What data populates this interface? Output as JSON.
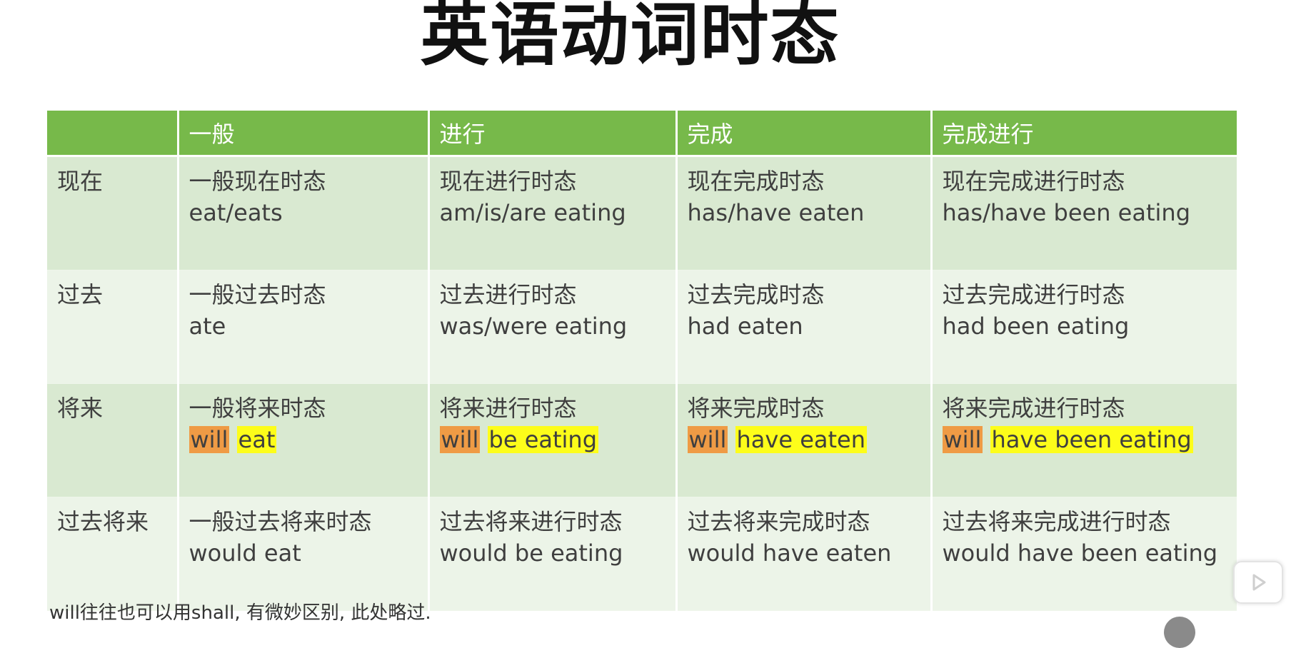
{
  "title": "英语动词时态",
  "table": {
    "headers": [
      "",
      "一般",
      "进行",
      "完成",
      "完成进行"
    ],
    "rows": [
      {
        "label": "现在",
        "cells": [
          {
            "name": "一般现在时态",
            "form": "eat/eats"
          },
          {
            "name": "现在进行时态",
            "form": "am/is/are eating"
          },
          {
            "name": "现在完成时态",
            "form": "has/have eaten"
          },
          {
            "name": "现在完成进行时态",
            "form": "has/have been eating"
          }
        ]
      },
      {
        "label": "过去",
        "cells": [
          {
            "name": "一般过去时态",
            "form": "ate"
          },
          {
            "name": "过去进行时态",
            "form": "was/were eating"
          },
          {
            "name": "过去完成时态",
            "form": "had eaten"
          },
          {
            "name": "过去完成进行时态",
            "form": "had been eating"
          }
        ]
      },
      {
        "label": "将来",
        "cells": [
          {
            "name": "一般将来时态",
            "form_will": "will",
            "form_rest": "eat"
          },
          {
            "name": "将来进行时态",
            "form_will": "will",
            "form_rest": "be eating"
          },
          {
            "name": "将来完成时态",
            "form_will": "will",
            "form_rest": "have eaten"
          },
          {
            "name": "将来完成进行时态",
            "form_will": "will",
            "form_rest": "have been eating"
          }
        ]
      },
      {
        "label": "过去将来",
        "cells": [
          {
            "name": "一般过去将来时态",
            "form": "would eat"
          },
          {
            "name": "过去将来进行时态",
            "form": "would be eating"
          },
          {
            "name": "过去将来完成时态",
            "form": "would have eaten"
          },
          {
            "name": "过去将来完成进行时态",
            "form": "would have been eating"
          }
        ]
      }
    ]
  },
  "colors": {
    "header_green": "#77b94a",
    "will_highlight": "#ef9b45",
    "verb_highlight": "#fdfd1a"
  },
  "footnote": "will往往也可以用shall, 有微妙区别, 此处略过.",
  "play_button": {
    "icon": "play-icon"
  }
}
